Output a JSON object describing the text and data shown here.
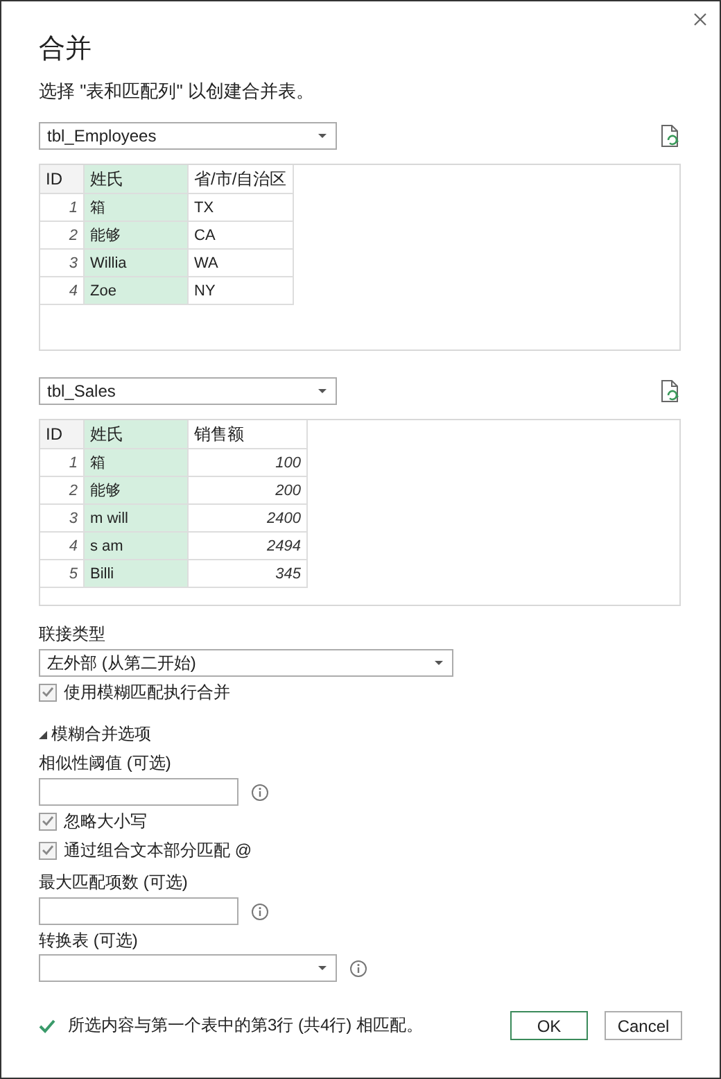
{
  "title": "合并",
  "subtitle": "选择 \"表和匹配列\" 以创建合并表。",
  "tables": [
    {
      "source": "tbl_Employees",
      "columns": [
        {
          "name": "ID",
          "kind": "index",
          "selected": false
        },
        {
          "name": "姓氏",
          "kind": "text",
          "selected": true
        },
        {
          "name": "省/市/自治区",
          "kind": "text",
          "selected": false
        }
      ],
      "rows": [
        [
          "1",
          "箱",
          "TX"
        ],
        [
          "2",
          "能够",
          "CA"
        ],
        [
          "3",
          "Willia",
          "WA"
        ],
        [
          "4",
          "Zoe",
          "NY"
        ]
      ]
    },
    {
      "source": "tbl_Sales",
      "columns": [
        {
          "name": "ID",
          "kind": "index",
          "selected": false
        },
        {
          "name": "姓氏",
          "kind": "text",
          "selected": true
        },
        {
          "name": "销售额",
          "kind": "number",
          "selected": false
        }
      ],
      "rows": [
        [
          "1",
          "箱",
          "100"
        ],
        [
          "2",
          "能够",
          "200"
        ],
        [
          "3",
          "m will",
          "2400"
        ],
        [
          "4",
          "s am",
          "2494"
        ],
        [
          "5",
          "Billi",
          "345"
        ]
      ]
    }
  ],
  "join": {
    "label": "联接类型",
    "value": "左外部 (从第二开始)"
  },
  "fuzzy_checkbox": {
    "label": "使用模糊匹配执行合并",
    "checked": true
  },
  "fuzzy_options": {
    "title": "模糊合并选项",
    "expanded": true,
    "items": [
      {
        "kind": "input",
        "label": "相似性阈值 (可选)"
      },
      {
        "kind": "checkbox",
        "label": "忽略大小写",
        "checked": true
      },
      {
        "kind": "checkbox",
        "label": "通过组合文本部分匹配 @",
        "checked": true
      },
      {
        "kind": "input",
        "label": "最大匹配项数 (可选)"
      },
      {
        "kind": "select",
        "label": "转换表 (可选)"
      }
    ]
  },
  "status": {
    "message": "所选内容与第一个表中的第3行 (共4行) 相匹配。",
    "ok": true
  },
  "buttons": [
    {
      "label": "OK",
      "default": true
    },
    {
      "label": "Cancel",
      "default": false
    }
  ]
}
